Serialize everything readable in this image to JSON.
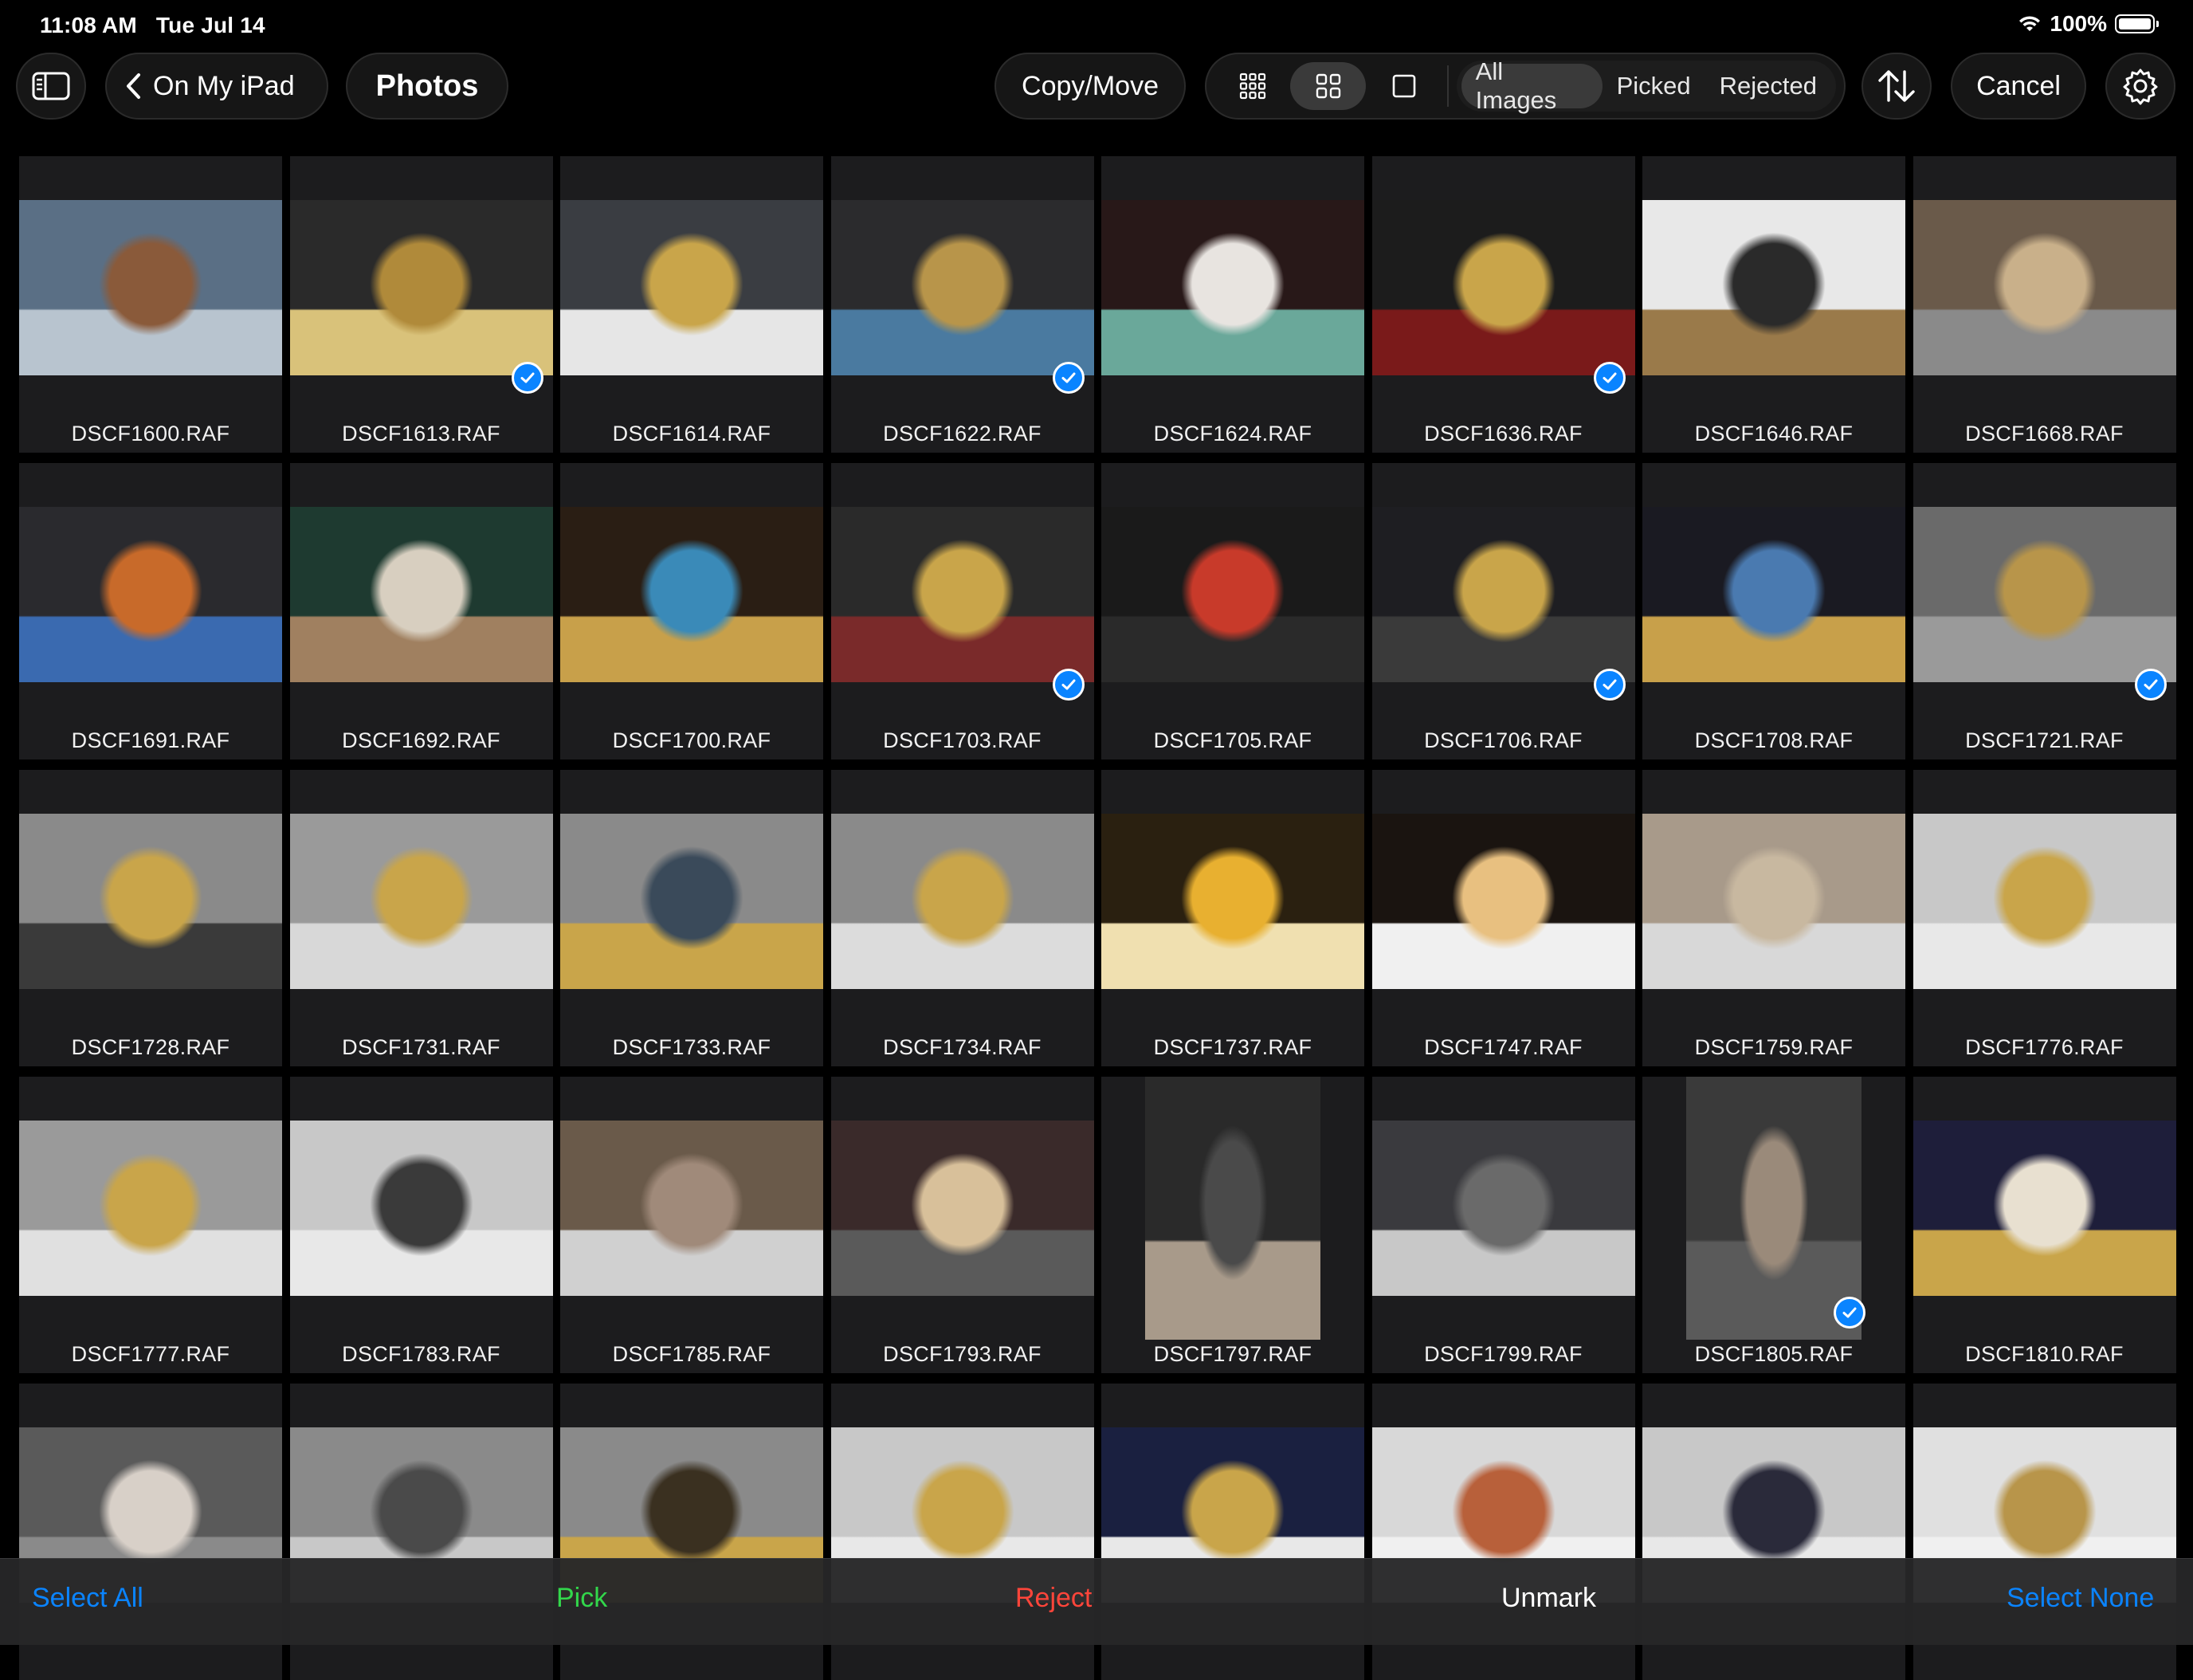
{
  "status_bar": {
    "time": "11:08 AM",
    "date": "Tue Jul 14",
    "battery": "100%"
  },
  "toolbar": {
    "back_label": "On My iPad",
    "photos_label": "Photos",
    "copy_move_label": "Copy/Move",
    "filters": [
      "All Images",
      "Picked",
      "Rejected"
    ],
    "active_filter": "All Images",
    "cancel_label": "Cancel"
  },
  "photos": [
    {
      "name": "DSCF1600.RAF",
      "checked": false
    },
    {
      "name": "DSCF1613.RAF",
      "checked": true
    },
    {
      "name": "DSCF1614.RAF",
      "checked": false
    },
    {
      "name": "DSCF1622.RAF",
      "checked": true
    },
    {
      "name": "DSCF1624.RAF",
      "checked": false
    },
    {
      "name": "DSCF1636.RAF",
      "checked": true
    },
    {
      "name": "DSCF1646.RAF",
      "checked": false
    },
    {
      "name": "DSCF1668.RAF",
      "checked": false
    },
    {
      "name": "DSCF1691.RAF",
      "checked": false
    },
    {
      "name": "DSCF1692.RAF",
      "checked": false
    },
    {
      "name": "DSCF1700.RAF",
      "checked": false
    },
    {
      "name": "DSCF1703.RAF",
      "checked": true
    },
    {
      "name": "DSCF1705.RAF",
      "checked": false
    },
    {
      "name": "DSCF1706.RAF",
      "checked": true
    },
    {
      "name": "DSCF1708.RAF",
      "checked": false
    },
    {
      "name": "DSCF1721.RAF",
      "checked": true
    },
    {
      "name": "DSCF1728.RAF",
      "checked": false
    },
    {
      "name": "DSCF1731.RAF",
      "checked": false
    },
    {
      "name": "DSCF1733.RAF",
      "checked": false
    },
    {
      "name": "DSCF1734.RAF",
      "checked": false
    },
    {
      "name": "DSCF1737.RAF",
      "checked": false
    },
    {
      "name": "DSCF1747.RAF",
      "checked": false
    },
    {
      "name": "DSCF1759.RAF",
      "checked": false
    },
    {
      "name": "DSCF1776.RAF",
      "checked": false
    },
    {
      "name": "DSCF1777.RAF",
      "checked": false
    },
    {
      "name": "DSCF1783.RAF",
      "checked": false
    },
    {
      "name": "DSCF1785.RAF",
      "checked": false
    },
    {
      "name": "DSCF1793.RAF",
      "checked": false
    },
    {
      "name": "DSCF1797.RAF",
      "checked": false,
      "portrait": true
    },
    {
      "name": "DSCF1799.RAF",
      "checked": false
    },
    {
      "name": "DSCF1805.RAF",
      "checked": true,
      "portrait": true
    },
    {
      "name": "DSCF1810.RAF",
      "checked": false
    },
    {
      "name": "",
      "checked": false
    },
    {
      "name": "",
      "checked": false
    },
    {
      "name": "",
      "checked": false
    },
    {
      "name": "",
      "checked": false
    },
    {
      "name": "",
      "checked": false
    },
    {
      "name": "",
      "checked": false
    },
    {
      "name": "",
      "checked": false
    },
    {
      "name": "",
      "checked": false
    }
  ],
  "bottom_bar": {
    "select_all": "Select All",
    "pick": "Pick",
    "reject": "Reject",
    "unmark": "Unmark",
    "select_none": "Select None"
  },
  "colors": {
    "accent": "#0a84ff",
    "pick": "#32d74b",
    "reject": "#ff453a"
  }
}
